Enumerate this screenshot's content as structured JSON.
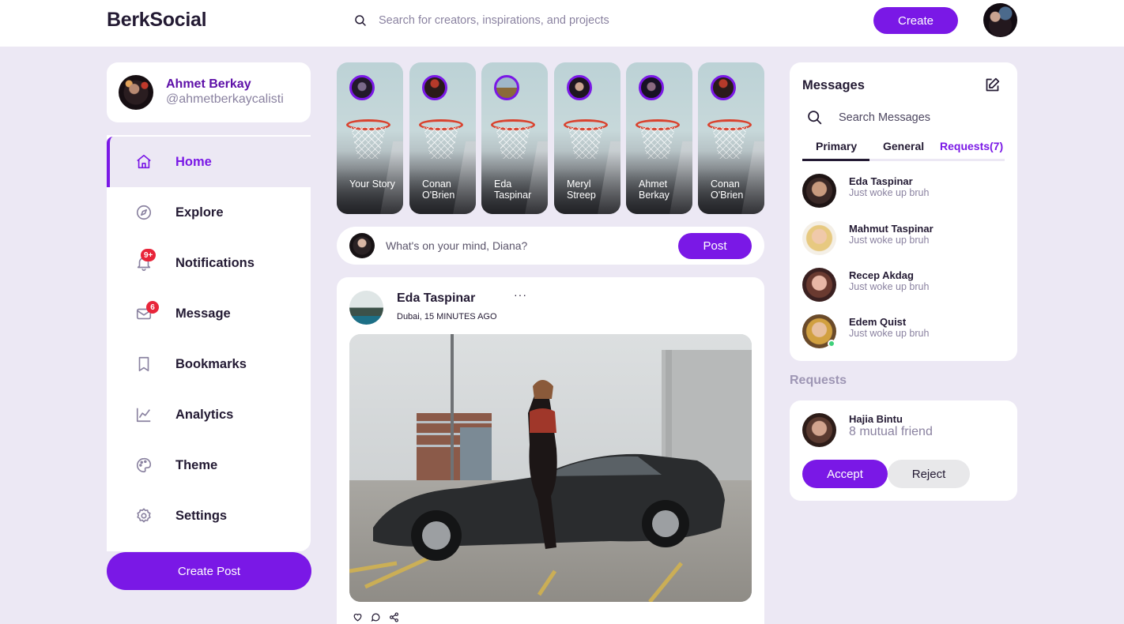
{
  "header": {
    "logo": "BerkSocial",
    "search_placeholder": "Search for creators, inspirations, and projects",
    "create_label": "Create"
  },
  "profile": {
    "name": "Ahmet Berkay",
    "handle": "@ahmetberkaycalisti"
  },
  "sidebar": {
    "items": [
      {
        "label": "Home",
        "icon": "home-icon",
        "active": true
      },
      {
        "label": "Explore",
        "icon": "compass-icon"
      },
      {
        "label": "Notifications",
        "icon": "bell-icon",
        "badge": "9+"
      },
      {
        "label": "Message",
        "icon": "mail-icon",
        "badge": "6"
      },
      {
        "label": "Bookmarks",
        "icon": "bookmark-icon"
      },
      {
        "label": "Analytics",
        "icon": "chart-icon"
      },
      {
        "label": "Theme",
        "icon": "palette-icon"
      },
      {
        "label": "Settings",
        "icon": "gear-icon"
      }
    ],
    "create_post_label": "Create Post"
  },
  "stories": [
    {
      "name": "Your Story"
    },
    {
      "name": "Conan O'Brien"
    },
    {
      "name": "Eda Taspinar"
    },
    {
      "name": "Meryl Streep"
    },
    {
      "name": "Ahmet Berkay"
    },
    {
      "name": "Conan O'Brien"
    }
  ],
  "composer": {
    "placeholder": "What's on your mind, Diana?",
    "post_label": "Post"
  },
  "post": {
    "author": "Eda Taspinar",
    "meta": "Dubai, 15 MINUTES AGO",
    "more": "···"
  },
  "messages": {
    "title": "Messages",
    "search_placeholder": "Search Messages",
    "tabs": [
      "Primary",
      "General",
      "Requests(7)"
    ],
    "contacts": [
      {
        "name": "Eda Taspinar",
        "message": "Just woke up bruh"
      },
      {
        "name": "Mahmut Taspinar",
        "message": "Just woke up bruh"
      },
      {
        "name": "Recep Akdag",
        "message": "Just woke up bruh"
      },
      {
        "name": "Edem Quist",
        "message": "Just woke up bruh",
        "online": true
      }
    ]
  },
  "requests": {
    "heading": "Requests",
    "name": "Hajia Bintu",
    "mutual": "8 mutual friend",
    "accept_label": "Accept",
    "reject_label": "Reject"
  },
  "colors": {
    "accent": "#7a18e6",
    "page_bg": "#ece8f4",
    "badge": "#e8253a",
    "online": "#3fd07a"
  }
}
